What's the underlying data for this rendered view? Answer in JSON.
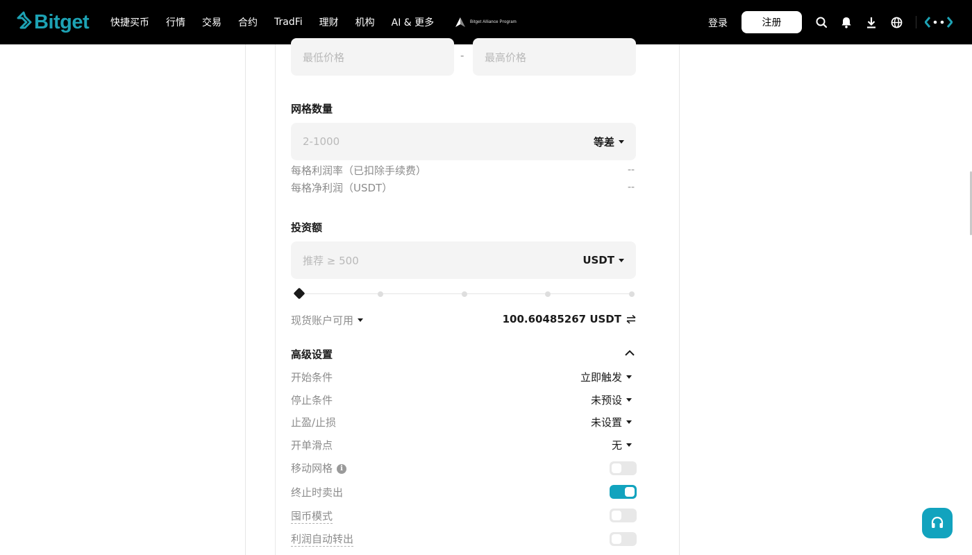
{
  "header": {
    "logo_text": "Bitget",
    "brand_color": "#1da2b4",
    "nav": [
      "快捷买币",
      "行情",
      "交易",
      "合约",
      "TradFi",
      "理财",
      "机构",
      "AI & 更多"
    ],
    "alliance_text": "Bitget Alliance Program",
    "login": "登录",
    "register": "注册",
    "icons": [
      "search-icon",
      "bell-icon",
      "download-icon",
      "globe-icon",
      "ai-icon"
    ]
  },
  "price_range": {
    "min_placeholder": "最低价格",
    "separator": "-",
    "max_placeholder": "最高价格"
  },
  "grid": {
    "title": "网格数量",
    "placeholder": "2-1000",
    "mode": "等差",
    "profit_rate_label": "每格利润率（已扣除手续费）",
    "profit_rate_value": "--",
    "net_profit_label": "每格净利润（USDT）",
    "net_profit_value": "--"
  },
  "investment": {
    "title": "投资额",
    "placeholder": "推荐 ≥ 500",
    "currency": "USDT",
    "slider_fraction": 0,
    "available_label": "现货账户可用",
    "available_value": "100.60485267 USDT"
  },
  "advanced": {
    "title": "高级设置",
    "rows": [
      {
        "label": "开始条件",
        "value": "立即触发"
      },
      {
        "label": "停止条件",
        "value": "未预设"
      },
      {
        "label": "止盈/止损",
        "value": "未设置"
      },
      {
        "label": "开单滑点",
        "value": "无"
      }
    ],
    "toggles": [
      {
        "label": "移动网格",
        "on": false
      },
      {
        "label": "终止时卖出",
        "on": true
      },
      {
        "label": "囤币模式",
        "on": false
      },
      {
        "label": "利润自动转出",
        "on": false
      }
    ]
  },
  "accent_color": "#12a3be"
}
